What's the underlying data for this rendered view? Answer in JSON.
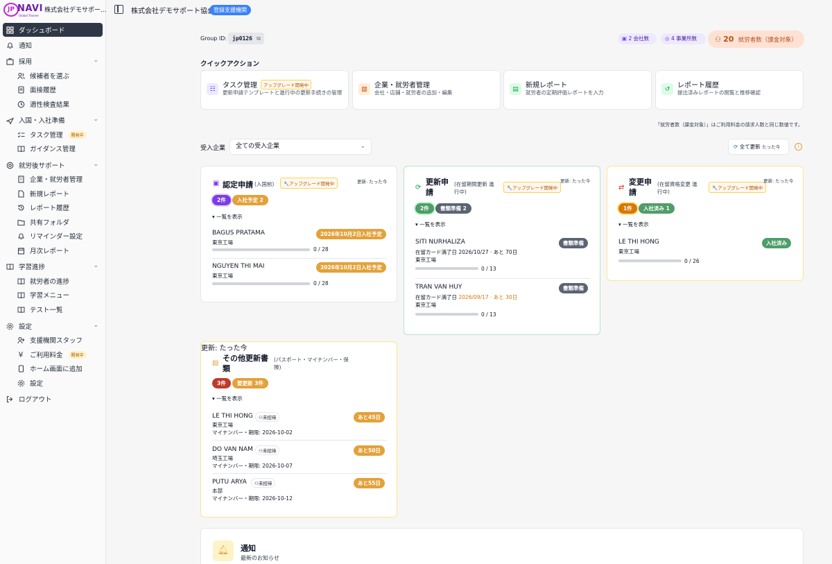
{
  "app": {
    "logo_text": "NAVI",
    "logo_mark": "JP",
    "logo_sub": "Global Trainee",
    "org_short": "株式会社デモサポー..."
  },
  "sidebar": {
    "dashboard": "ダッシュボード",
    "notifications": "通知",
    "recruit": "採用",
    "recruit_items": [
      "候補者を選ぶ",
      "面接履歴",
      "適性検査結果"
    ],
    "entry": "入国・入社準備",
    "entry_items": [
      "タスク管理",
      "ガイダンス管理"
    ],
    "dev_badge": "開発中",
    "support": "就労後サポート",
    "support_items": [
      "企業・就労者管理",
      "新規レポート",
      "レポート履歴",
      "共有フォルダ",
      "リマインダー設定",
      "月次レポート"
    ],
    "learning": "学習進捗",
    "learning_items": [
      "就労者の進捗",
      "学習メニュー",
      "テスト一覧"
    ],
    "settings": "設定",
    "settings_items": [
      "支援機関スタッフ",
      "ご利用料金",
      "ホーム画面に追加",
      "設定"
    ],
    "logout": "ログアウト"
  },
  "topbar": {
    "title": "株式会社デモサポート協会",
    "badge": "登録支援機関"
  },
  "summary": {
    "group_label": "Group ID:",
    "group_id": "jp0126",
    "companies": "2 会社数",
    "offices": "4 事業所数",
    "workers_num": "20",
    "workers_label": "就労者数（課金対象）"
  },
  "quick": {
    "heading": "クイックアクション",
    "items": [
      {
        "title": "タスク管理",
        "badge": "アップグレード開発中",
        "desc": "更新申請テンプレートと進行中の更新手続きの管理"
      },
      {
        "title": "企業・就労者管理",
        "desc": "会社・店舗・就労者の追加・編集"
      },
      {
        "title": "新規レポート",
        "desc": "就労者の定期評価レポートを入力"
      },
      {
        "title": "レポート履歴",
        "desc": "提出済みレポートの閲覧と推移確認"
      }
    ],
    "note": "「就労者数（課金対象）」はご利用料金の請求人数と同じ数値です。"
  },
  "filter": {
    "label": "受入企業",
    "value": "全ての受入企業",
    "refresh": "全て更新",
    "refresh_time": "たった今"
  },
  "common": {
    "upgrade": "アップグレード開発中",
    "updated": "更新: たった今",
    "show_list": "▾ 一覧を表示",
    "uninvited": "未招待"
  },
  "cards": {
    "nintei": {
      "title": "認定申請",
      "subtitle": "(入国前)",
      "count": "2件",
      "chip2": "入社予定 2",
      "rows": [
        {
          "name": "BAGUS PRATAMA",
          "loc": "東京工場",
          "tag": "2026年10月2日入社予定",
          "count": "0 / 28",
          "progress": 0
        },
        {
          "name": "NGUYEN THI MAI",
          "loc": "東京工場",
          "tag": "2026年10月2日入社予定",
          "count": "0 / 28",
          "progress": 0
        }
      ]
    },
    "koushin": {
      "title": "更新申\n請",
      "subtitle": "(在留期間更新 進行中)",
      "count": "2件",
      "chip2": "書類準備 2",
      "rows": [
        {
          "name": "SITI NURHALIZA",
          "line": "在留カード満了日 2026/10/27 · あと 70日",
          "loc": "東京工場",
          "tag": "書類準備",
          "count": "0 / 13",
          "progress": 0
        },
        {
          "name": "TRAN VAN HUY",
          "line_a": "在留カード満了日 ",
          "line_b": "2026/09/17 · あと 30日",
          "loc": "東京工場",
          "tag": "書類準備",
          "count": "0 / 13",
          "progress": 0
        }
      ]
    },
    "henkou": {
      "title": "変更申\n請",
      "subtitle": "(在留資格変更 進行中)",
      "count": "1件",
      "chip2": "入社済み 1",
      "rows": [
        {
          "name": "LE THI HONG",
          "loc": "東京工場",
          "tag": "入社済み",
          "count": "0 / 26",
          "progress": 0
        }
      ]
    },
    "other": {
      "title": "その他更新書\n類",
      "subtitle": "(パスポート・マイナンバー・保険)",
      "count": "3件",
      "chip2": "要更新 3件",
      "rows": [
        {
          "name": "LE THI HONG",
          "loc": "東京工場",
          "detail": "マイナンバー・期限: 2026-10-02",
          "tag": "あと45日"
        },
        {
          "name": "DO VAN NAM",
          "loc": "埼玉工場",
          "detail": "マイナンバー・期限: 2026-10-07",
          "tag": "あと50日"
        },
        {
          "name": "PUTU ARYA",
          "loc": "本部",
          "detail": "マイナンバー・期限: 2026-10-12",
          "tag": "あと55日"
        }
      ]
    }
  },
  "notice": {
    "title": "通知",
    "subtitle": "最新のお知らせ"
  },
  "colors": {
    "sidebar_active": "#2f3645",
    "accent_blue": "#3b82f6",
    "orange": "#e3a13a",
    "purple": "#7c3aed",
    "green": "#4f9d69",
    "red": "#c0392b"
  }
}
